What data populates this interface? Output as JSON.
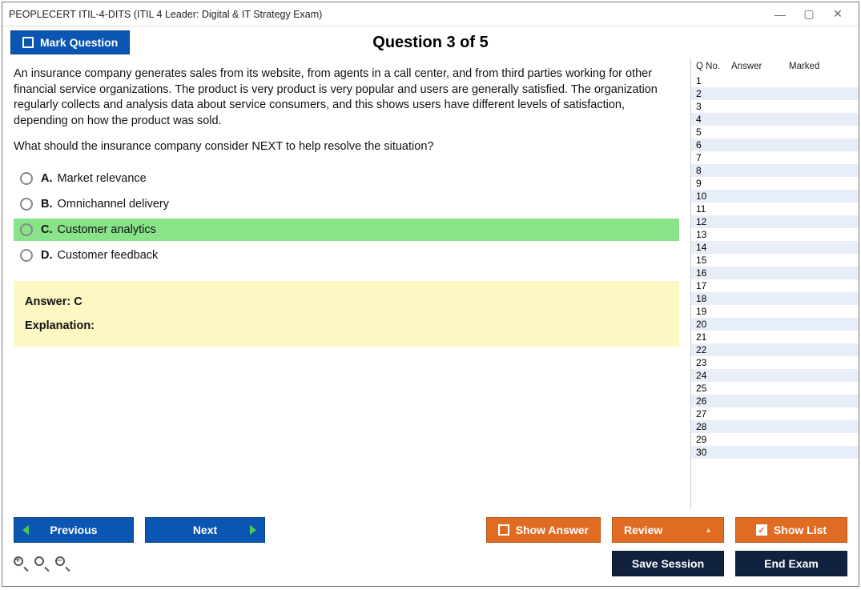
{
  "window": {
    "title": "PEOPLECERT ITIL-4-DITS (ITIL 4 Leader: Digital & IT Strategy Exam)"
  },
  "topbar": {
    "mark_label": "Mark Question",
    "question_header": "Question 3 of 5"
  },
  "question": {
    "text": "An insurance company generates sales from its website, from agents in a call center, and from third parties working for other financial service organizations. The product is very product is very popular and users are generally satisfied. The organization regularly collects and analysis data about service consumers, and this shows users have different levels of satisfaction, depending on how the product was sold.",
    "followup": "What should the insurance company consider NEXT to help resolve the situation?",
    "options": [
      {
        "letter": "A.",
        "text": "Market relevance",
        "selected": false
      },
      {
        "letter": "B.",
        "text": "Omnichannel delivery",
        "selected": false
      },
      {
        "letter": "C.",
        "text": "Customer analytics",
        "selected": true
      },
      {
        "letter": "D.",
        "text": "Customer feedback",
        "selected": false
      }
    ],
    "answer_line": "Answer: C",
    "explanation_label": "Explanation:"
  },
  "side": {
    "col_qno": "Q No.",
    "col_answer": "Answer",
    "col_marked": "Marked",
    "rows": [
      1,
      2,
      3,
      4,
      5,
      6,
      7,
      8,
      9,
      10,
      11,
      12,
      13,
      14,
      15,
      16,
      17,
      18,
      19,
      20,
      21,
      22,
      23,
      24,
      25,
      26,
      27,
      28,
      29,
      30
    ]
  },
  "footer": {
    "previous": "Previous",
    "next": "Next",
    "show_answer": "Show Answer",
    "review": "Review",
    "show_list": "Show List",
    "save_session": "Save Session",
    "end_exam": "End Exam"
  }
}
